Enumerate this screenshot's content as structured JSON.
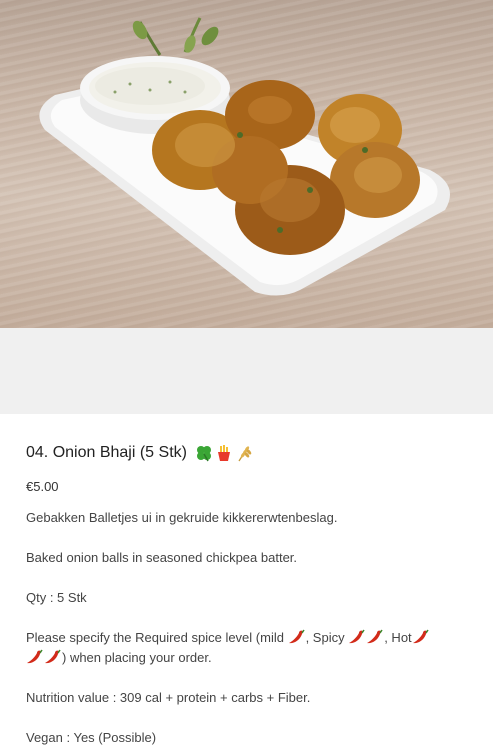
{
  "product": {
    "image_alt": "Onion Bhaji with yogurt dip",
    "title": "04. Onion Bhaji (5 Stk)",
    "badges": [
      "clover-icon",
      "fries-icon",
      "wheat-icon"
    ],
    "price": "€5.00",
    "description_de": "Gebakken Balletjes ui in gekruide kikkererwtenbeslag.",
    "description_en": "Baked onion balls in seasoned chickpea batter.",
    "qty": "Qty : 5 Stk",
    "spice": {
      "part1": "Please specify the Required spice level (mild ",
      "part2": ", Spicy ",
      "part3": ", Hot",
      "part4": ") when placing your order."
    },
    "nutrition": "Nutrition value : 309 cal + protein + carbs + Fiber.",
    "vegan": "Vegan : Yes (Possible)"
  },
  "colors": {
    "chili": "#d22b1a",
    "clover": "#3aa635",
    "fries": "#e8392b"
  }
}
